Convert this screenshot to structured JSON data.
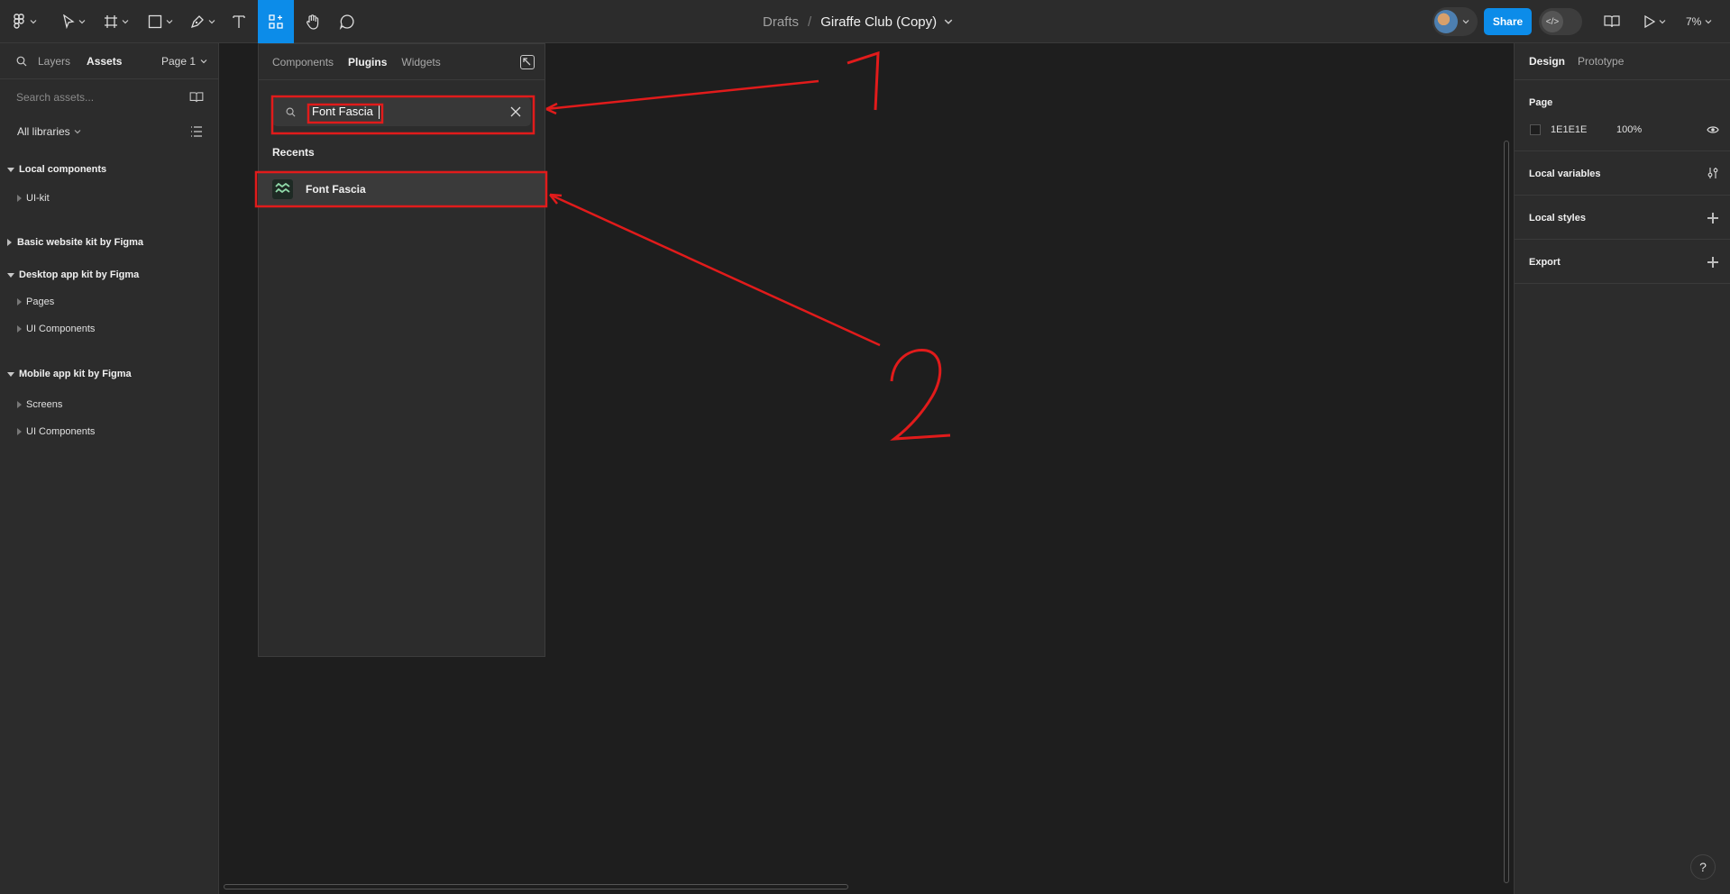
{
  "toolbar": {
    "breadcrumb_drafts": "Drafts",
    "breadcrumb_sep": "/",
    "file_name": "Giraffe Club (Copy)",
    "share_label": "Share",
    "zoom_label": "7%",
    "accent_color": "#0c8ce9"
  },
  "left_panel": {
    "tabs": [
      "Layers",
      "Assets"
    ],
    "active_tab": "Assets",
    "page_label": "Page 1",
    "search_placeholder": "Search assets...",
    "libraries_label": "All libraries",
    "tree": [
      {
        "label": "Local components",
        "kind": "group"
      },
      {
        "label": "UI-kit",
        "kind": "item"
      },
      {
        "label": "Basic website kit by Figma",
        "kind": "group-collapsed"
      },
      {
        "label": "Desktop app kit by Figma",
        "kind": "group"
      },
      {
        "label": "Pages",
        "kind": "item"
      },
      {
        "label": "UI Components",
        "kind": "item"
      },
      {
        "label": "Mobile app kit by Figma",
        "kind": "group"
      },
      {
        "label": "Screens",
        "kind": "item"
      },
      {
        "label": "UI Components",
        "kind": "item"
      }
    ]
  },
  "popup": {
    "tabs": [
      "Components",
      "Plugins",
      "Widgets"
    ],
    "active_tab": "Plugins",
    "search_value": "Font Fascia",
    "recents_heading": "Recents",
    "recent_plugins": [
      {
        "name": "Font Fascia"
      }
    ]
  },
  "right_panel": {
    "tabs": [
      "Design",
      "Prototype"
    ],
    "active_tab": "Design",
    "page_heading": "Page",
    "page_color_hex": "1E1E1E",
    "page_opacity": "100%",
    "local_variables": "Local variables",
    "local_styles": "Local styles",
    "export": "Export"
  },
  "annotations": {
    "label_1": "1",
    "label_2": "2",
    "color": "#e11b1b"
  },
  "help_label": "?"
}
